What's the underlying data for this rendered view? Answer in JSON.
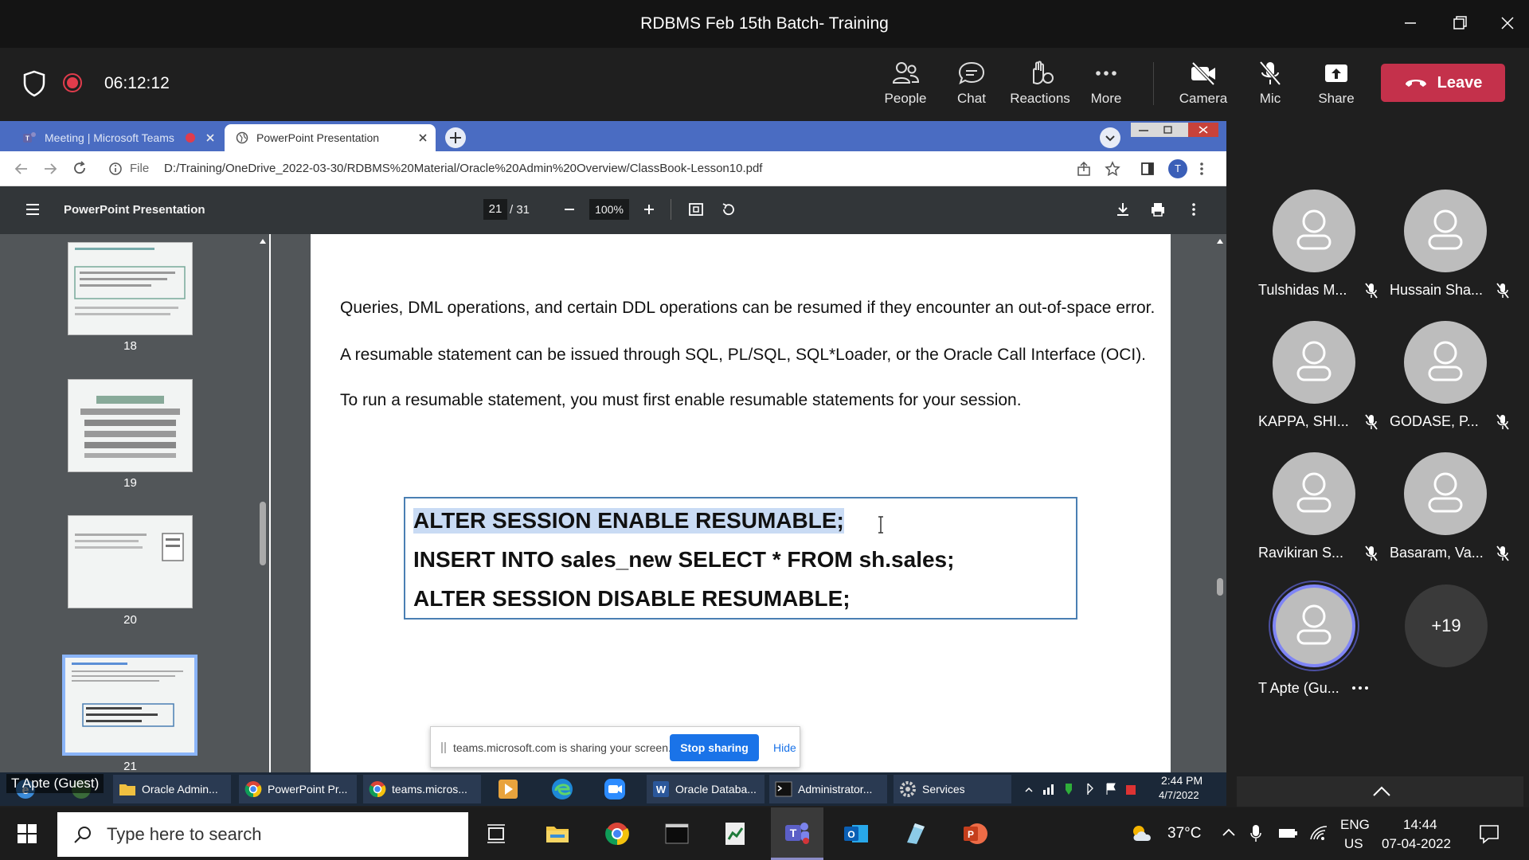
{
  "window": {
    "title": "RDBMS Feb 15th Batch- Training"
  },
  "toolbar": {
    "timer": "06:12:12",
    "people": "People",
    "chat": "Chat",
    "reactions": "Reactions",
    "more": "More",
    "camera": "Camera",
    "mic": "Mic",
    "share": "Share",
    "leave": "Leave"
  },
  "browser": {
    "tab1": "Meeting | Microsoft Teams",
    "tab2": "PowerPoint Presentation",
    "url_scheme": "File",
    "url": "D:/Training/OneDrive_2022-03-30/RDBMS%20Material/Oracle%20Admin%20Overview/ClassBook-Lesson10.pdf",
    "profile_initial": "T"
  },
  "pdf": {
    "title": "PowerPoint Presentation",
    "page_current": "21",
    "page_total": "/ 31",
    "zoom": "100%",
    "thumbs": [
      "18",
      "19",
      "20",
      "21"
    ],
    "para1": "Queries, DML operations, and certain DDL operations can be resumed if they encounter an out-of-space error.",
    "para2": "A resumable statement can be issued through SQL, PL/SQL, SQL*Loader, or the Oracle Call Interface (OCI).",
    "para3": "To run a resumable statement, you must first enable resumable statements for your session.",
    "code1": "ALTER SESSION ENABLE RESUMABLE;",
    "code2": "INSERT INTO sales_new SELECT * FROM sh.sales;",
    "code3": "ALTER SESSION DISABLE RESUMABLE;"
  },
  "sharebar": {
    "text": "teams.microsoft.com is sharing your screen.",
    "stop": "Stop sharing",
    "hide": "Hide"
  },
  "inner_taskbar": {
    "items": [
      "Oracle Admin...",
      "PowerPoint Pr...",
      "teams.micros...",
      "Oracle Databa...",
      "Administrator...",
      "Services"
    ],
    "time": "2:44 PM",
    "date": "4/7/2022"
  },
  "guest_label": "T Apte (Guest)",
  "participants": [
    {
      "name": "Tulshidas M..."
    },
    {
      "name": "Hussain Sha..."
    },
    {
      "name": "KAPPA, SHI..."
    },
    {
      "name": "GODASE, P..."
    },
    {
      "name": "Ravikiran S..."
    },
    {
      "name": "Basaram, Va..."
    },
    {
      "name": "T Apte (Gu..."
    }
  ],
  "more_participants": "+19",
  "taskbar": {
    "search_placeholder": "Type here to search",
    "temperature": "37°C",
    "lang1": "ENG",
    "lang2": "US",
    "time": "14:44",
    "date": "07-04-2022"
  },
  "colors": {
    "leave": "#c4314b",
    "chrome_blue": "#4a6cc2",
    "pdf_toolbar": "#323639",
    "stop_sharing": "#1a73e8"
  }
}
